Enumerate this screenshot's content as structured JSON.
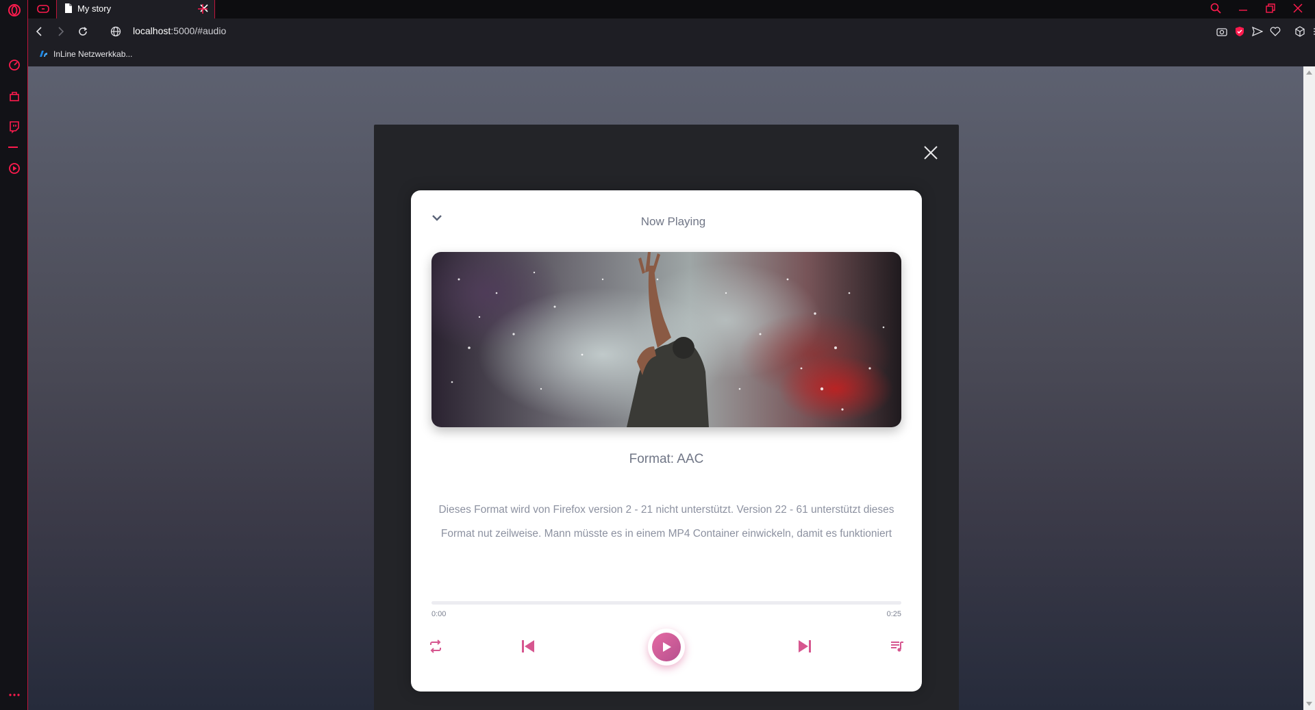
{
  "browser": {
    "tab_title": "My story",
    "url_host": "localhost",
    "url_rest": ":5000/#audio",
    "bookmark_label": "InLine Netzwerkkab..."
  },
  "player": {
    "header": "Now Playing",
    "format_label": "Format: AAC",
    "description": "Dieses Format wird von Firefox version 2 - 21 nicht unterstützt. Version 22 - 61 unterstützt dieses Format nut zeilweise. Mann müsste es in einem MP4 Container einwickeln, damit es funktioniert",
    "time_current": "0:00",
    "time_total": "0:25",
    "progress": 0
  },
  "icons": {
    "close": "close-icon",
    "collapse": "chevron-down-icon",
    "repeat": "repeat-icon",
    "previous": "skip-previous-icon",
    "play": "play-icon",
    "next": "skip-next-icon",
    "playlist": "playlist-icon"
  },
  "colors": {
    "accent": "#d6568f",
    "browser_accent": "#ff1b4e"
  }
}
